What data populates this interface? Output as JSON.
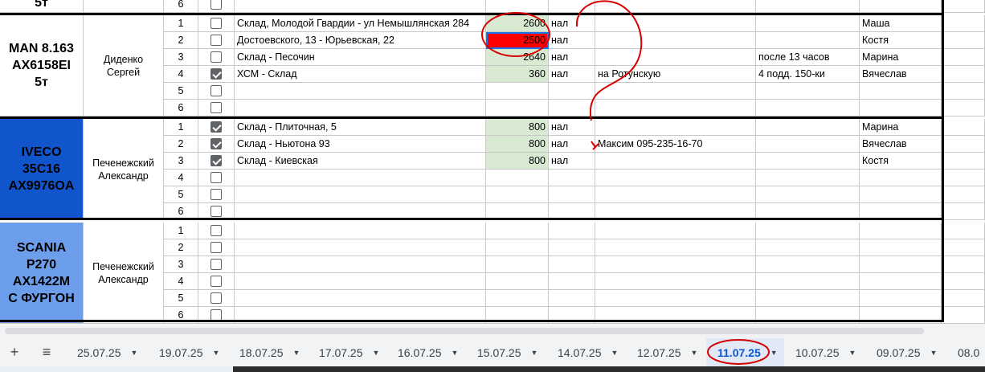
{
  "top_partial": {
    "vehicle": "5т",
    "row_num": "6"
  },
  "groups": [
    {
      "vehicle": "MAN 8.163\nAX6158EI\n5т",
      "driver": "Диденко\nСергей",
      "vehicle_color": "#ffffff",
      "rows": [
        {
          "num": "1",
          "checked": false,
          "address": "Склад, Молодой Гвардии - ул Немышлянская 284",
          "price": "2600",
          "pay": "нал",
          "note": "",
          "time": "",
          "person": "Маша"
        },
        {
          "num": "2",
          "checked": false,
          "address": "Достоевского, 13 - Юрьевская, 22",
          "price": "2500",
          "pay": "нал",
          "note": "",
          "time": "",
          "person": "Костя",
          "selected": true
        },
        {
          "num": "3",
          "checked": false,
          "address": "Склад - Песочин",
          "price": "2640",
          "pay": "нал",
          "note": "",
          "time": "после 13 часов",
          "person": "Марина"
        },
        {
          "num": "4",
          "checked": true,
          "address": "ХСМ - Склад",
          "price": "360",
          "pay": "нал",
          "note": "на Ротунскую",
          "time": "4 подд. 150-ки",
          "person": "Вячеслав"
        },
        {
          "num": "5",
          "checked": false,
          "address": "",
          "price": "",
          "pay": "",
          "note": "",
          "time": "",
          "person": ""
        },
        {
          "num": "6",
          "checked": false,
          "address": "",
          "price": "",
          "pay": "",
          "note": "",
          "time": "",
          "person": ""
        }
      ]
    },
    {
      "vehicle": "IVECO\n35C16\nAX9976OA",
      "driver": "Печенежский\nАлександр",
      "vehicle_color": "#1155cc",
      "rows": [
        {
          "num": "1",
          "checked": true,
          "address": "Склад - Плиточная, 5",
          "price": "800",
          "pay": "нал",
          "note": "",
          "time": "",
          "person": "Марина"
        },
        {
          "num": "2",
          "checked": true,
          "address": "Склад - Ньютона 93",
          "price": "800",
          "pay": "нал",
          "note": "Максим 095-235-16-70",
          "time": "",
          "person": "Вячеслав"
        },
        {
          "num": "3",
          "checked": true,
          "address": "Склад - Киевская",
          "price": "800",
          "pay": "нал",
          "note": "",
          "time": "",
          "person": "Костя"
        },
        {
          "num": "4",
          "checked": false,
          "address": "",
          "price": "",
          "pay": "",
          "note": "",
          "time": "",
          "person": ""
        },
        {
          "num": "5",
          "checked": false,
          "address": "",
          "price": "",
          "pay": "",
          "note": "",
          "time": "",
          "person": ""
        },
        {
          "num": "6",
          "checked": false,
          "address": "",
          "price": "",
          "pay": "",
          "note": "",
          "time": "",
          "person": ""
        }
      ]
    },
    {
      "vehicle": "SCANIA\nP270\nAX1422M\nС ФУРГОН",
      "driver": "Печенежский\nАлександр",
      "vehicle_color": "#6d9eeb",
      "rows": [
        {
          "num": "1",
          "checked": false,
          "address": "",
          "price": "",
          "pay": "",
          "note": "",
          "time": "",
          "person": ""
        },
        {
          "num": "2",
          "checked": false,
          "address": "",
          "price": "",
          "pay": "",
          "note": "",
          "time": "",
          "person": ""
        },
        {
          "num": "3",
          "checked": false,
          "address": "",
          "price": "",
          "pay": "",
          "note": "",
          "time": "",
          "person": ""
        },
        {
          "num": "4",
          "checked": false,
          "address": "",
          "price": "",
          "pay": "",
          "note": "",
          "time": "",
          "person": ""
        },
        {
          "num": "5",
          "checked": false,
          "address": "",
          "price": "",
          "pay": "",
          "note": "",
          "time": "",
          "person": ""
        },
        {
          "num": "6",
          "checked": false,
          "address": "",
          "price": "",
          "pay": "",
          "note": "",
          "time": "",
          "person": ""
        }
      ]
    }
  ],
  "tabs": {
    "add_icon": "+",
    "menu_icon": "≡",
    "sheets": [
      "25.07.25",
      "19.07.25",
      "18.07.25",
      "17.07.25",
      "16.07.25",
      "15.07.25",
      "14.07.25",
      "12.07.25",
      "11.07.25",
      "10.07.25",
      "09.07.25",
      "08.0"
    ],
    "active_index": 8,
    "caret": "▼"
  },
  "colors": {
    "annotation": "#d80000",
    "price_fill": "#d9ead3",
    "selected_fill": "#ff0000",
    "active_tab": "#0b57d0"
  }
}
